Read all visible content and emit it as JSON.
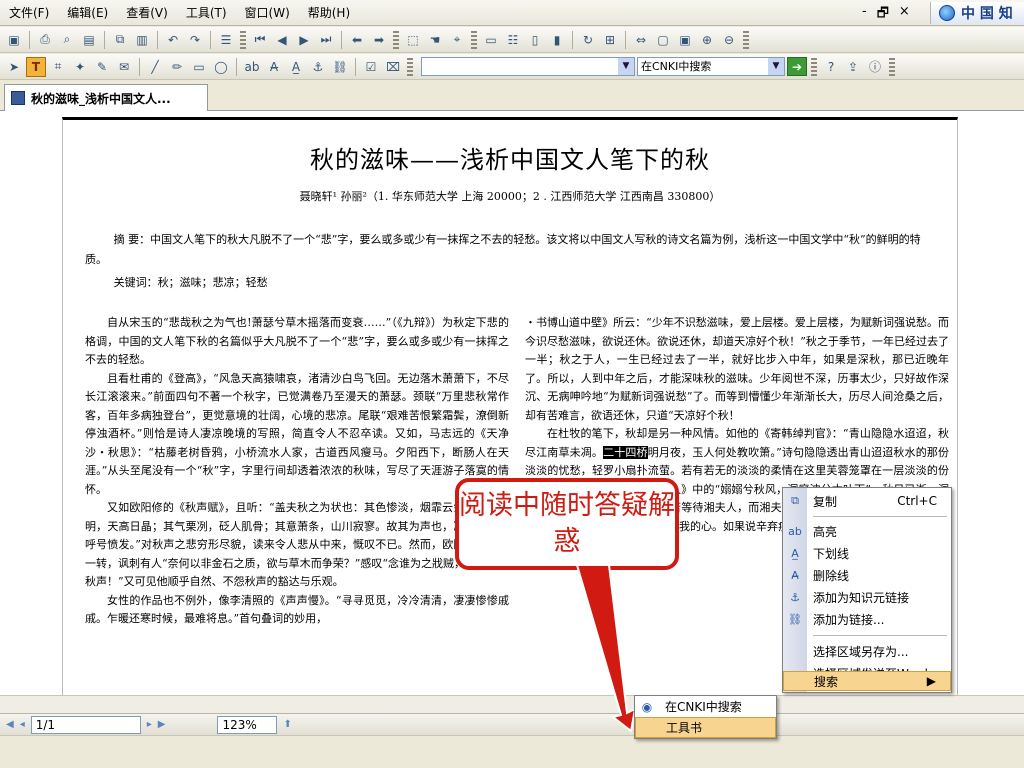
{
  "menubar": {
    "items": [
      "文件(F)",
      "编辑(E)",
      "查看(V)",
      "工具(T)",
      "窗口(W)",
      "帮助(H)"
    ],
    "controls": [
      "-",
      "🗗",
      "×"
    ],
    "brand": "中 国 知"
  },
  "toolbar2": {
    "search_scope": "在CNKI中搜索"
  },
  "tab": {
    "label": "秋的滋味_浅析中国文人..."
  },
  "document": {
    "title": "秋的滋味——浅析中国文人笔下的秋",
    "authors": "聂晓轩¹  孙丽²（1. 华东师范大学 上海 20000；2 . 江西师范大学 江西南昌 330800）",
    "abstract": "摘 要：中国文人笔下的秋大凡脱不了一个“悲”字，要么或多或少有一抹挥之不去的轻愁。该文将以中国文人写秋的诗文名篇为例，浅析这一中国文学中“秋”的鲜明的特质。",
    "keywords": "关键词：秋；滋味；悲凉；轻愁",
    "left_column": [
      "自从宋玉的“悲哉秋之为气也!萧瑟兮草木摇落而变衰……”（《九辩》）为秋定下悲的格调，中国的文人笔下秋的名篇似乎大凡脱不了一个“悲”字，要么或多或少有一抹挥之不去的轻愁。",
      "且看杜甫的《登高》，“风急天高猿啸哀，渚清沙白鸟飞回。无边落木萧萧下，不尽长江滚滚来。”前面四句不著一个秋字，已觉满卷乃至漫天的萧瑟。颈联“万里悲秋常作客，百年多病独登台”，更觉意境的壮阔，心境的悲凉。尾联“艰难苦恨繁霜鬓，潦倒新停浊酒杯。”则恰是诗人凄凉晚境的写照，简直令人不忍卒读。又如，马志远的《天净沙・秋思》：“枯藤老树昏鸦，小桥流水人家，古道西风瘦马。夕阳西下，断肠人在天涯。”从头至尾没有一个“秋”字，字里行间却透着浓浓的秋味，写尽了天涯游子落寞的情怀。",
      "又如欧阳修的《秋声赋》，且听：“盖夫秋之为状也：其色惨淡，烟霏云敛；其容清明，天高日晶；其气栗冽，砭人肌骨；其意萧条，山川寂寥。故其为声也，凄凄切切，呼号愤发。”对秋声之悲穷形尽貌，读来令人悲从中来，慨叹不已。然而，欧阳先生笔锋一转，讽刺有人“奈何以非金石之质，欲与草木而争荣？”感叹“念谁为之戕贼，亦何恨乎秋声！”又可见他顺乎自然、不怨秋声的豁达与乐观。",
      "女性的作品也不例外，像李清照的《声声慢》。“寻寻觅觅，冷冷清清，凄凄惨惨戚戚。乍暖还寒时候，最难将息。”首句叠词的妙用，"
    ],
    "right_column": [
      "・书博山道中壁》所云：“少年不识愁滋味，爱上层楼。爱上层楼，为赋新词强说愁。而今识尽愁滋味，欲说还休。欲说还休，却道天凉好个秋！”秋之于季节，一年已经过去了一半；秋之于人，一生已经过去了一半，就好比步入中年，如果是深秋，那已近晚年了。所以，人到中年之后，才能深味秋的滋味。少年阅世不深，历事太少，只好故作深沉、无病呻吟地“为赋新词强说愁”了。而等到懵懂少年渐渐长大，历尽人间沧桑之后，却有苦难言，欲语还休，只道“天凉好个秋！",
      "在杜牧的笔下，秋却是另一种风情。如他的《寄韩绰判官》：“青山隐隐水迢迢，秋尽江南草未凋。",
      "二十四桥",
      "明月夜，玉人何处教吹箫。”诗句隐隐透出青山迢迢秋水的那份淡淡的忧愁，轻罗小扇扑流萤。若有若无的淡淡的柔情在这里芙蓉笼罩在一层淡淡的份刻骨的相思，起了屈原《湘夫人》中的“嫋嫋兮秋风，洞庭波兮木叶下”。秋日已逝，洞庭秋景仍在，君在洞庭湖畔苦苦等待湘夫人，而湘夫人却迟迟不来，痴情，以及久等不至的怅惘和那份淡淡的忧愁，着我的心。如果说辛弃疾秋为“秋”定下"
    ]
  },
  "callout": {
    "text": "阅读中随时答疑解惑"
  },
  "context_menu": {
    "items": [
      {
        "icon": "copy-icon",
        "label": "复制",
        "shortcut": "Ctrl+C"
      },
      {
        "icon": "highlight-icon",
        "label": "高亮"
      },
      {
        "icon": "underline-icon",
        "label": "下划线"
      },
      {
        "icon": "strikethrough-icon",
        "label": "删除线"
      },
      {
        "icon": "anchor-icon",
        "label": "添加为知识元链接"
      },
      {
        "icon": "link-icon",
        "label": "添加为链接..."
      },
      {
        "label": "选择区域另存为..."
      },
      {
        "label": "选择区域发送至Word"
      },
      {
        "label": "搜索",
        "has_submenu": true
      }
    ]
  },
  "submenu": {
    "items": [
      {
        "icon": "cnki-search-icon",
        "label": "在CNKI中搜索"
      },
      {
        "label": "工具书"
      }
    ]
  },
  "statusbar": {
    "page": "1/1",
    "zoom": "123%"
  },
  "colors": {
    "callout_border": "#d11a12",
    "menu_selected": "#f7d590"
  }
}
